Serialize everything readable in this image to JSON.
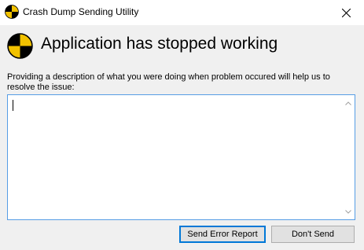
{
  "window": {
    "title": "Crash Dump Sending Utility"
  },
  "header": {
    "headline": "Application has stopped working"
  },
  "form": {
    "description": "Providing a description of what you were doing when problem occured will help us to resolve the issue:",
    "textarea_value": ""
  },
  "buttons": {
    "send_label": "Send Error Report",
    "dont_send_label": "Don't Send"
  },
  "icons": {
    "app": "crash-test-dummy-icon",
    "close": "close-icon",
    "scroll_up": "chevron-up-icon",
    "scroll_down": "chevron-down-icon"
  },
  "colors": {
    "focus_border": "#569de5",
    "default_button_border": "#0078d7",
    "icon_yellow": "#f2c200",
    "icon_black": "#000000"
  }
}
